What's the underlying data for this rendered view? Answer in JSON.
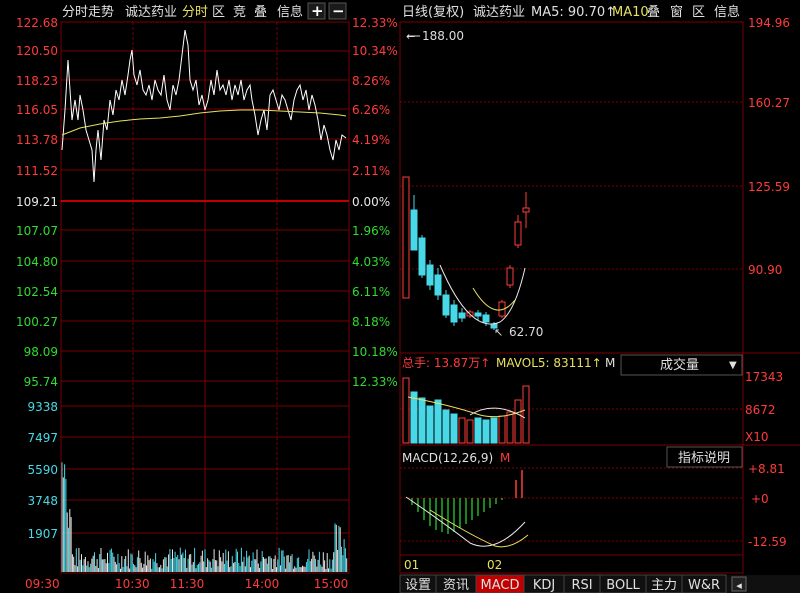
{
  "left_panel": {
    "tabs": [
      "分时走势",
      "诚达药业",
      "分时",
      "区",
      "竞",
      "叠",
      "信息"
    ],
    "plus": "+",
    "minus": "−",
    "price_labels_red": [
      "122.68",
      "120.50",
      "118.23",
      "116.05",
      "113.78",
      "111.52"
    ],
    "pct_labels_red": [
      "12.33%",
      "10.34%",
      "8.26%",
      "6.26%",
      "4.19%",
      "2.11%"
    ],
    "base_price": "109.21",
    "base_pct": "0.00%",
    "price_labels_green": [
      "107.07",
      "104.80",
      "102.54",
      "100.27",
      "98.09",
      "95.74"
    ],
    "pct_labels_green": [
      "1.96%",
      "4.03%",
      "6.11%",
      "8.18%",
      "10.18%",
      "12.33%"
    ],
    "volume_labels": [
      "9338",
      "7497",
      "5590",
      "3748",
      "1907"
    ],
    "time_labels": [
      "09:30",
      "10:30",
      "11:30",
      "14:00",
      "15:00"
    ]
  },
  "right_panel": {
    "title": "日线(复权)",
    "stock": "诚达药业",
    "ma5_label": "MA5: 90.70↑",
    "ma10_label": "MA10",
    "tabs": [
      "叠",
      "窗",
      "区",
      "信息"
    ],
    "price_labels": [
      "194.96",
      "160.27",
      "125.59",
      "90.90"
    ],
    "high_marker": "188.00",
    "low_marker": "62.70",
    "vol_header": {
      "total": "总手: 13.87万↑",
      "mavol": "MAVOL5: 83111↑",
      "ma_cut": "M"
    },
    "vol_dropdown": "成交量",
    "vol_labels": [
      "17343",
      "8672"
    ],
    "vol_unit": "X10",
    "macd_header": "MACD(12,26,9)",
    "macd_cut": "M",
    "macd_button": "指标说明",
    "macd_labels": [
      "+8.81",
      "+0",
      "-12.59"
    ],
    "date_labels": [
      "01",
      "02"
    ]
  },
  "bottom_tabs": [
    "设置",
    "资讯",
    "MACD",
    "KDJ",
    "RSI",
    "BOLL",
    "主力",
    "W&R"
  ],
  "bottom_arrow": "◂",
  "colors": {
    "red": "#ff3b3b",
    "green": "#2fdc2f",
    "grid": "#7a0000",
    "cyan": "#48d8e8",
    "yellow": "#e8e060",
    "tab_active": "#c00000"
  }
}
